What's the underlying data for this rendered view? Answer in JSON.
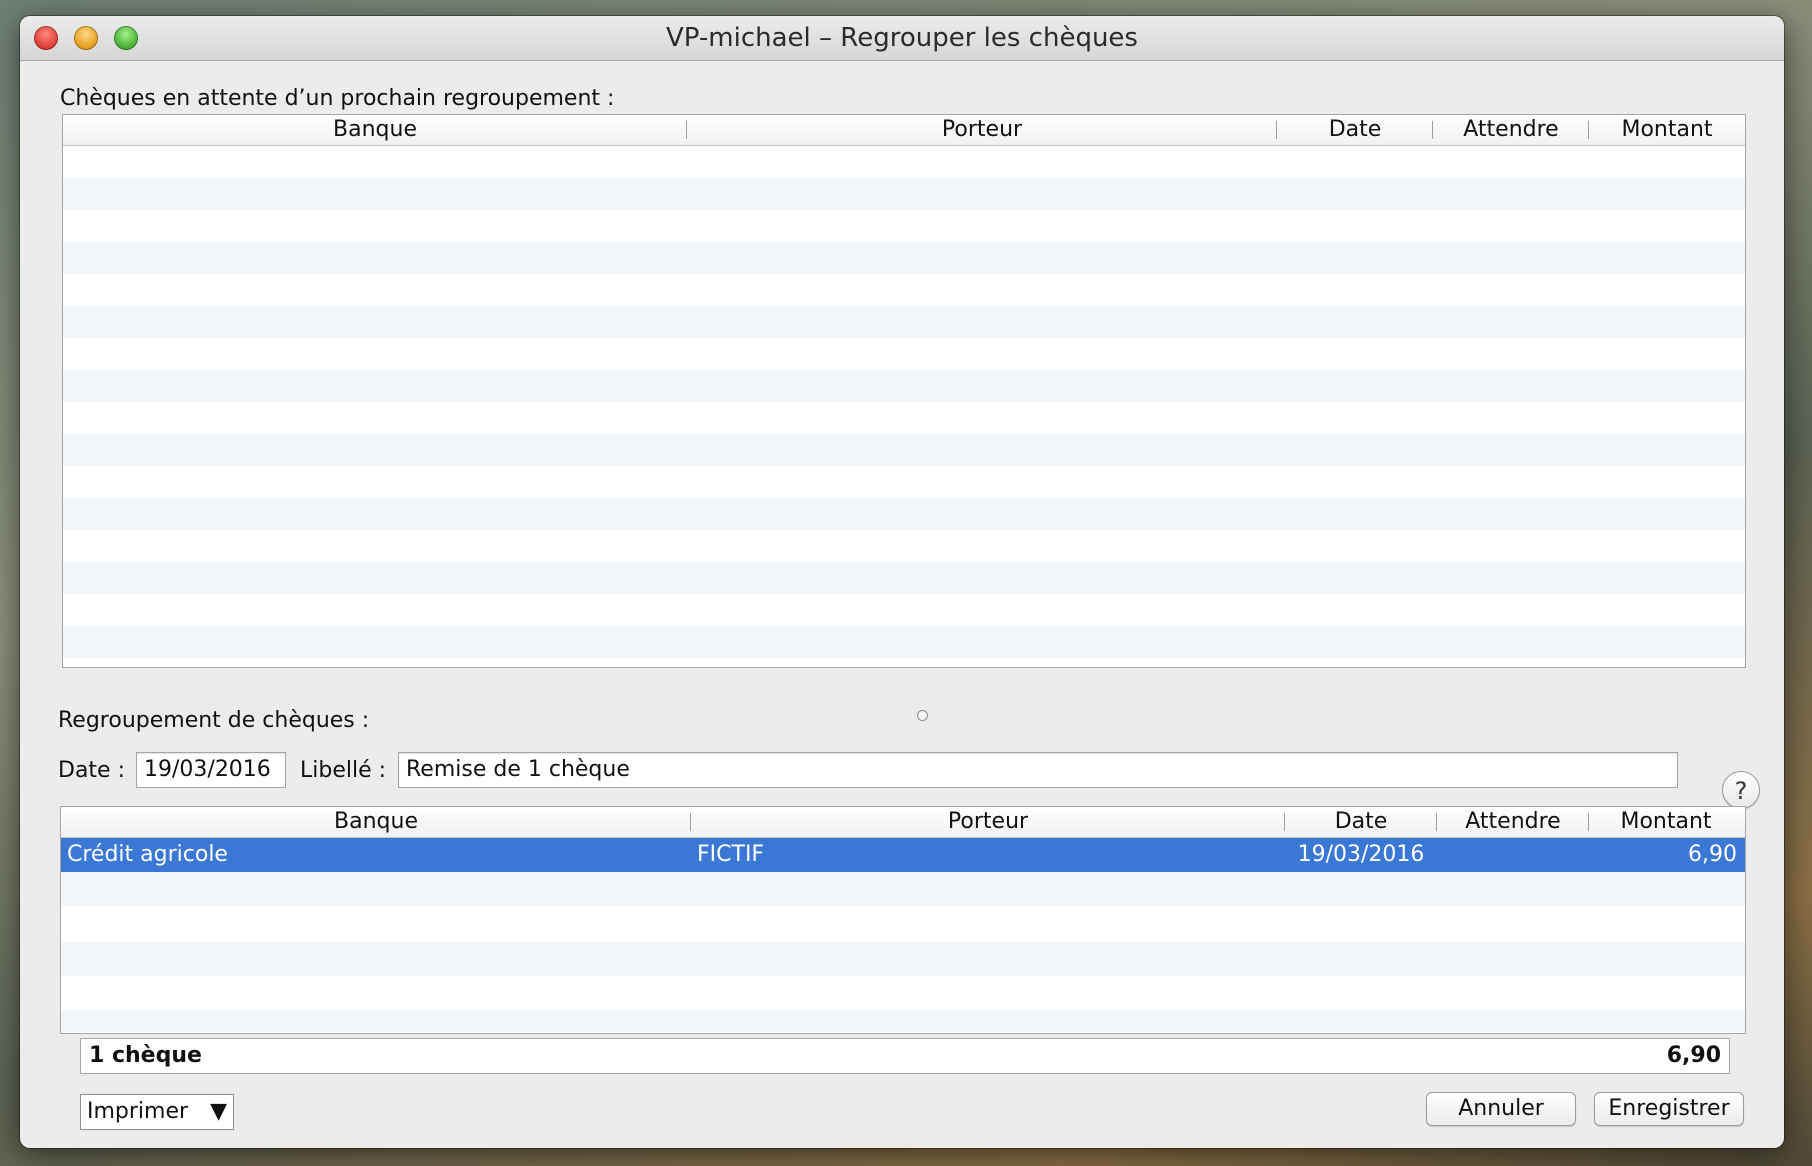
{
  "window": {
    "title": "VP-michael – Regrouper les chèques"
  },
  "pending": {
    "label": "Chèques en attente d’un prochain regroupement :",
    "columns": [
      "Banque",
      "Porteur",
      "Date",
      "Attendre",
      "Montant"
    ],
    "rows": []
  },
  "group": {
    "label": "Regroupement de chèques :",
    "date_label": "Date :",
    "date_value": "19/03/2016",
    "libelle_label": "Libellé :",
    "libelle_value": "Remise de 1 chèque",
    "help_glyph": "?",
    "columns": [
      "Banque",
      "Porteur",
      "Date",
      "Attendre",
      "Montant"
    ],
    "rows": [
      {
        "banque": "Crédit agricole",
        "porteur": "FICTIF",
        "date": "19/03/2016",
        "attendre": "",
        "montant": "6,90",
        "selected": true
      }
    ],
    "total_count": "1 chèque",
    "total_amount": "6,90"
  },
  "footer": {
    "print_label": "Imprimer",
    "print_arrow": "▼",
    "cancel_label": "Annuler",
    "save_label": "Enregistrer"
  },
  "colors": {
    "selection": "#3b78d6",
    "stripe": "#f2f5fa",
    "window_bg": "#ececec"
  }
}
